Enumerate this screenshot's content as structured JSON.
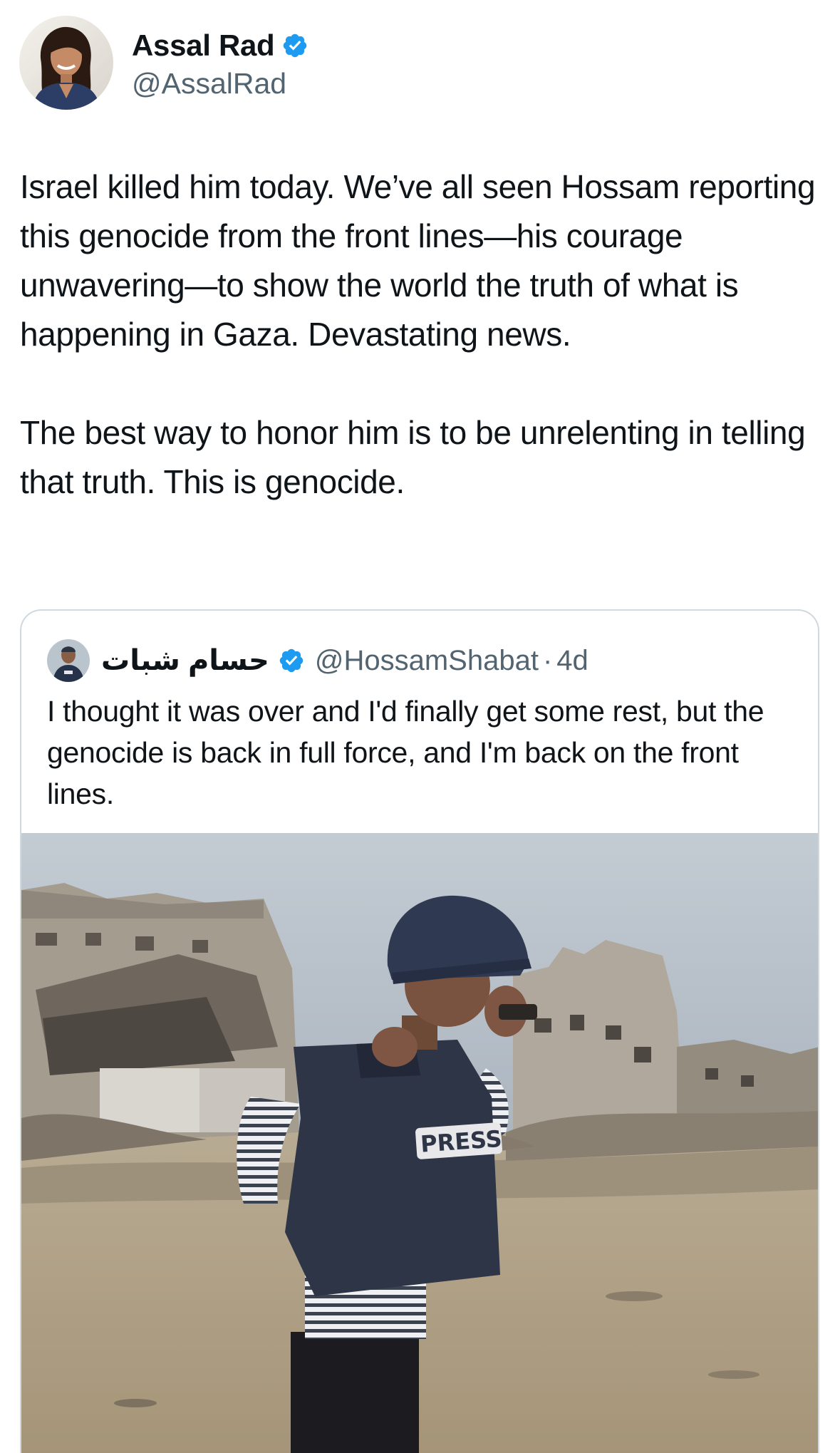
{
  "author": {
    "display_name": "Assal Rad",
    "handle": "@AssalRad",
    "verified": true,
    "avatar_icon": "profile-photo-woman"
  },
  "tweet": {
    "paragraph_1": "Israel killed him today. We’ve all seen Hossam reporting this genocide from the front lines—his courage unwavering—to show the world the truth of what is happening in Gaza. Devastating news.",
    "paragraph_2": "The best way to honor him is to be unrelenting in telling that truth. This is genocide."
  },
  "quoted_tweet": {
    "display_name": "حسام شبات",
    "handle": "@HossamShabat",
    "separator": "·",
    "time": "4d",
    "verified": true,
    "text": "I thought it was over and I'd finally get some rest, but the genocide is back in full force, and I'm back on the front lines.",
    "media": {
      "vest_label": "PRESS"
    }
  },
  "colors": {
    "verified_blue": "#1d9bf0",
    "secondary_text": "#536471",
    "border": "#cfd9de"
  }
}
